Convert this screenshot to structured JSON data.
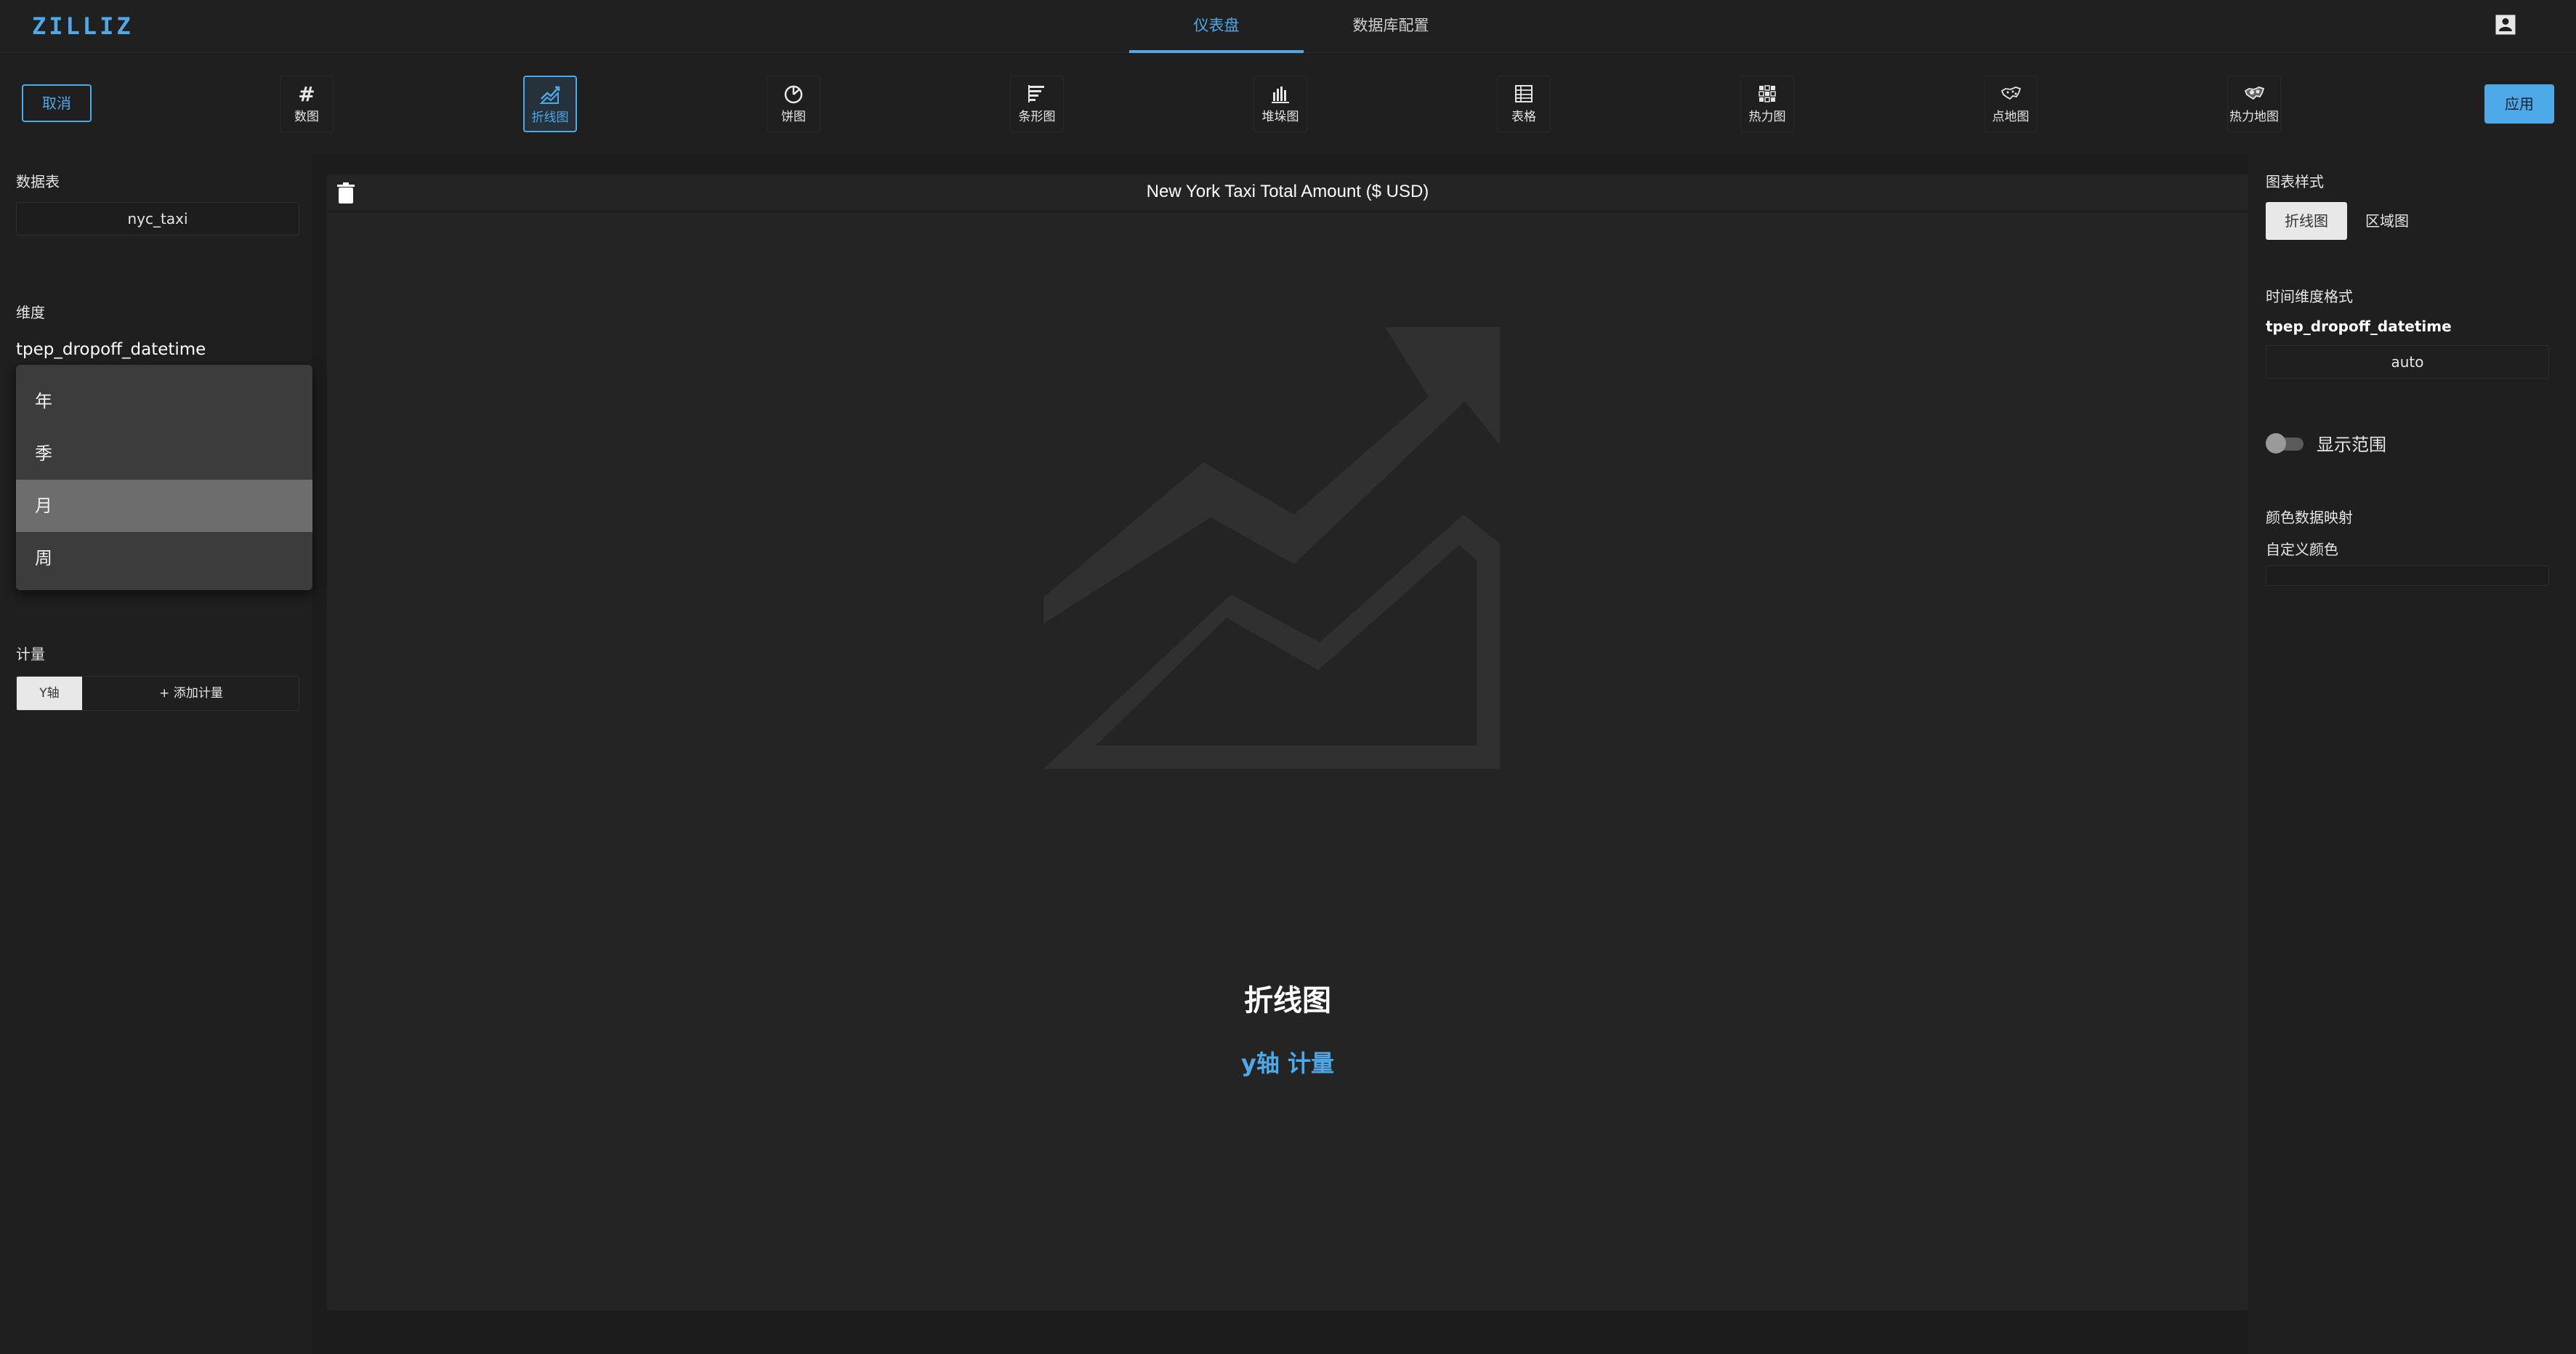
{
  "header": {
    "logo": "ZILLIZ",
    "tabs": [
      {
        "label": "仪表盘",
        "active": true
      },
      {
        "label": "数据库配置",
        "active": false
      }
    ]
  },
  "toolbar": {
    "cancel_label": "取消",
    "apply_label": "应用",
    "chart_types": [
      {
        "label": "数图",
        "icon": "hash-icon",
        "active": false
      },
      {
        "label": "折线图",
        "icon": "line-chart-icon",
        "active": true
      },
      {
        "label": "饼图",
        "icon": "pie-chart-icon",
        "active": false
      },
      {
        "label": "条形图",
        "icon": "bar-chart-icon",
        "active": false
      },
      {
        "label": "堆垛图",
        "icon": "stacked-chart-icon",
        "active": false
      },
      {
        "label": "表格",
        "icon": "table-icon",
        "active": false
      },
      {
        "label": "热力图",
        "icon": "heatmap-icon",
        "active": false
      },
      {
        "label": "点地图",
        "icon": "point-map-icon",
        "active": false
      },
      {
        "label": "热力地图",
        "icon": "heat-map-geo-icon",
        "active": false
      }
    ]
  },
  "left": {
    "datatable_title": "数据表",
    "datatable_value": "nyc_taxi",
    "dimension_title": "维度",
    "dimension_field": "tpep_dropoff_datetime",
    "dropdown_options": [
      "年",
      "季",
      "月",
      "周"
    ],
    "dropdown_selected": "月",
    "measure_title": "计量",
    "yaxis_label": "Y轴",
    "add_measure_label": "+ 添加计量"
  },
  "center": {
    "title": "New York Taxi Total Amount ($ USD)",
    "placeholder_title": "折线图",
    "placeholder_subtitle": "y轴 计量"
  },
  "right": {
    "chart_style_title": "图表样式",
    "style_options": [
      "折线图",
      "区域图"
    ],
    "style_selected": "折线图",
    "time_format_title": "时间维度格式",
    "time_field": "tpep_dropoff_datetime",
    "time_format_value": "auto",
    "show_range_label": "显示范围",
    "show_range_on": false,
    "color_mapping_title": "颜色数据映射",
    "custom_color_label": "自定义颜色"
  },
  "colors": {
    "accent": "#4ea9e8",
    "background": "#1c1c1c",
    "panel": "#242424"
  }
}
